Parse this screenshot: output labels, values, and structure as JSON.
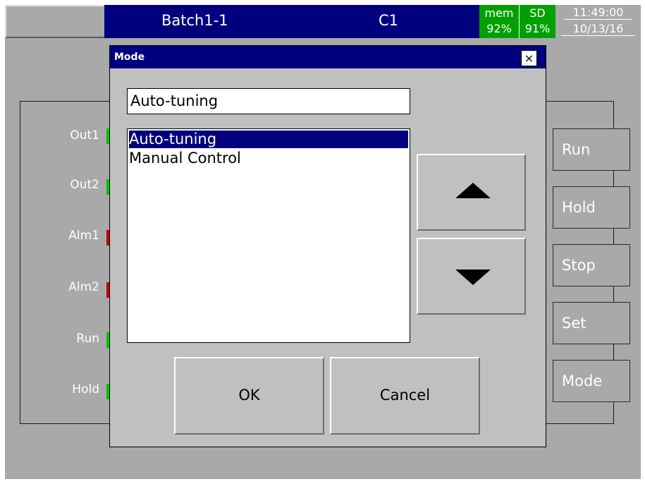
{
  "header": {
    "batch_name": "Batch1-1",
    "channel": "C1",
    "mem_label": "mem",
    "mem_value": "92%",
    "sd_label": "SD",
    "sd_value": "91%",
    "time": "11:49:00",
    "date": "10/13/16"
  },
  "panel": {
    "rows": [
      {
        "label": "Out1",
        "led_color": "#00c000"
      },
      {
        "label": "Out2",
        "led_color": "#00c000"
      },
      {
        "label": "Alm1",
        "led_color": "#c00000"
      },
      {
        "label": "Alm2",
        "led_color": "#c00000"
      },
      {
        "label": "Run",
        "led_color": "#00c000"
      },
      {
        "label": "Hold",
        "led_color": "#00c000"
      }
    ],
    "buttons": [
      "Run",
      "Hold",
      "Stop",
      "Set",
      "Mode"
    ]
  },
  "dialog": {
    "title": "Mode",
    "close_glyph": "×",
    "field_value": "Auto-tuning",
    "options": [
      "Auto-tuning",
      "Manual Control"
    ],
    "selected_index": 0,
    "ok_label": "OK",
    "cancel_label": "Cancel",
    "up_icon": "up-arrow-icon",
    "down_icon": "down-arrow-icon"
  },
  "colors": {
    "title_bar": "#00007f",
    "status_green": "#00a000",
    "background": "#a9a9a9",
    "dialog_face": "#c0c0c0"
  }
}
